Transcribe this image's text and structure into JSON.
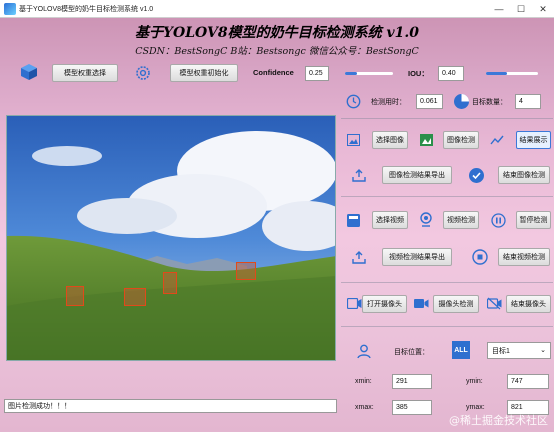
{
  "window": {
    "title": "基于YOLOV8模型的奶牛目标检测系统 v1.0",
    "minimize": "—",
    "maximize": "☐",
    "close": "✕"
  },
  "header": {
    "title": "基于YOLOV8模型的奶牛目标检测系统 v1.0",
    "subtitle": "CSDN：BestSongC    B站：Bestsongc    微信公众号：BestSongC"
  },
  "toolbar": {
    "model_select_label": "模型权重选择",
    "model_init_label": "模型权重初始化",
    "confidence_label": "Confidence",
    "confidence_value": "0.25",
    "iou_label": "IOU：",
    "iou_value": "0.40"
  },
  "stats": {
    "time_label": "检测用时：",
    "time_value": "0.061",
    "count_label": "目标数量：",
    "count_value": "4"
  },
  "image_section": {
    "select_image": "选择图像",
    "detect_image": "图像检测",
    "show_result": "结果展示",
    "export_result": "图像检测结果导出",
    "end_detect": "结束图像检测"
  },
  "video_section": {
    "select_video": "选择视频",
    "detect_video": "视频检测",
    "pause_detect": "暂停检测",
    "export_result": "视频检测结果导出",
    "end_detect": "结束视频检测"
  },
  "camera_section": {
    "open_camera": "打开摄像头",
    "detect_camera": "摄像头检测",
    "close_camera": "结束摄像头"
  },
  "target": {
    "position_label": "目标位置：",
    "all_badge": "ALL",
    "selected_target": "目标1",
    "xmin_label": "xmin:",
    "xmin_value": "291",
    "ymin_label": "ymin:",
    "ymin_value": "747",
    "xmax_label": "xmax:",
    "xmax_value": "385",
    "ymax_label": "ymax:",
    "ymax_value": "821"
  },
  "status_bar": {
    "message": "图片检测成功！！！"
  },
  "watermark": "@稀土掘金技术社区",
  "colors": {
    "accent": "#3c78d8",
    "detection_box": "#e04a1a"
  },
  "detections": [
    {
      "id": 1
    },
    {
      "id": 2
    },
    {
      "id": 3
    },
    {
      "id": 4
    }
  ]
}
